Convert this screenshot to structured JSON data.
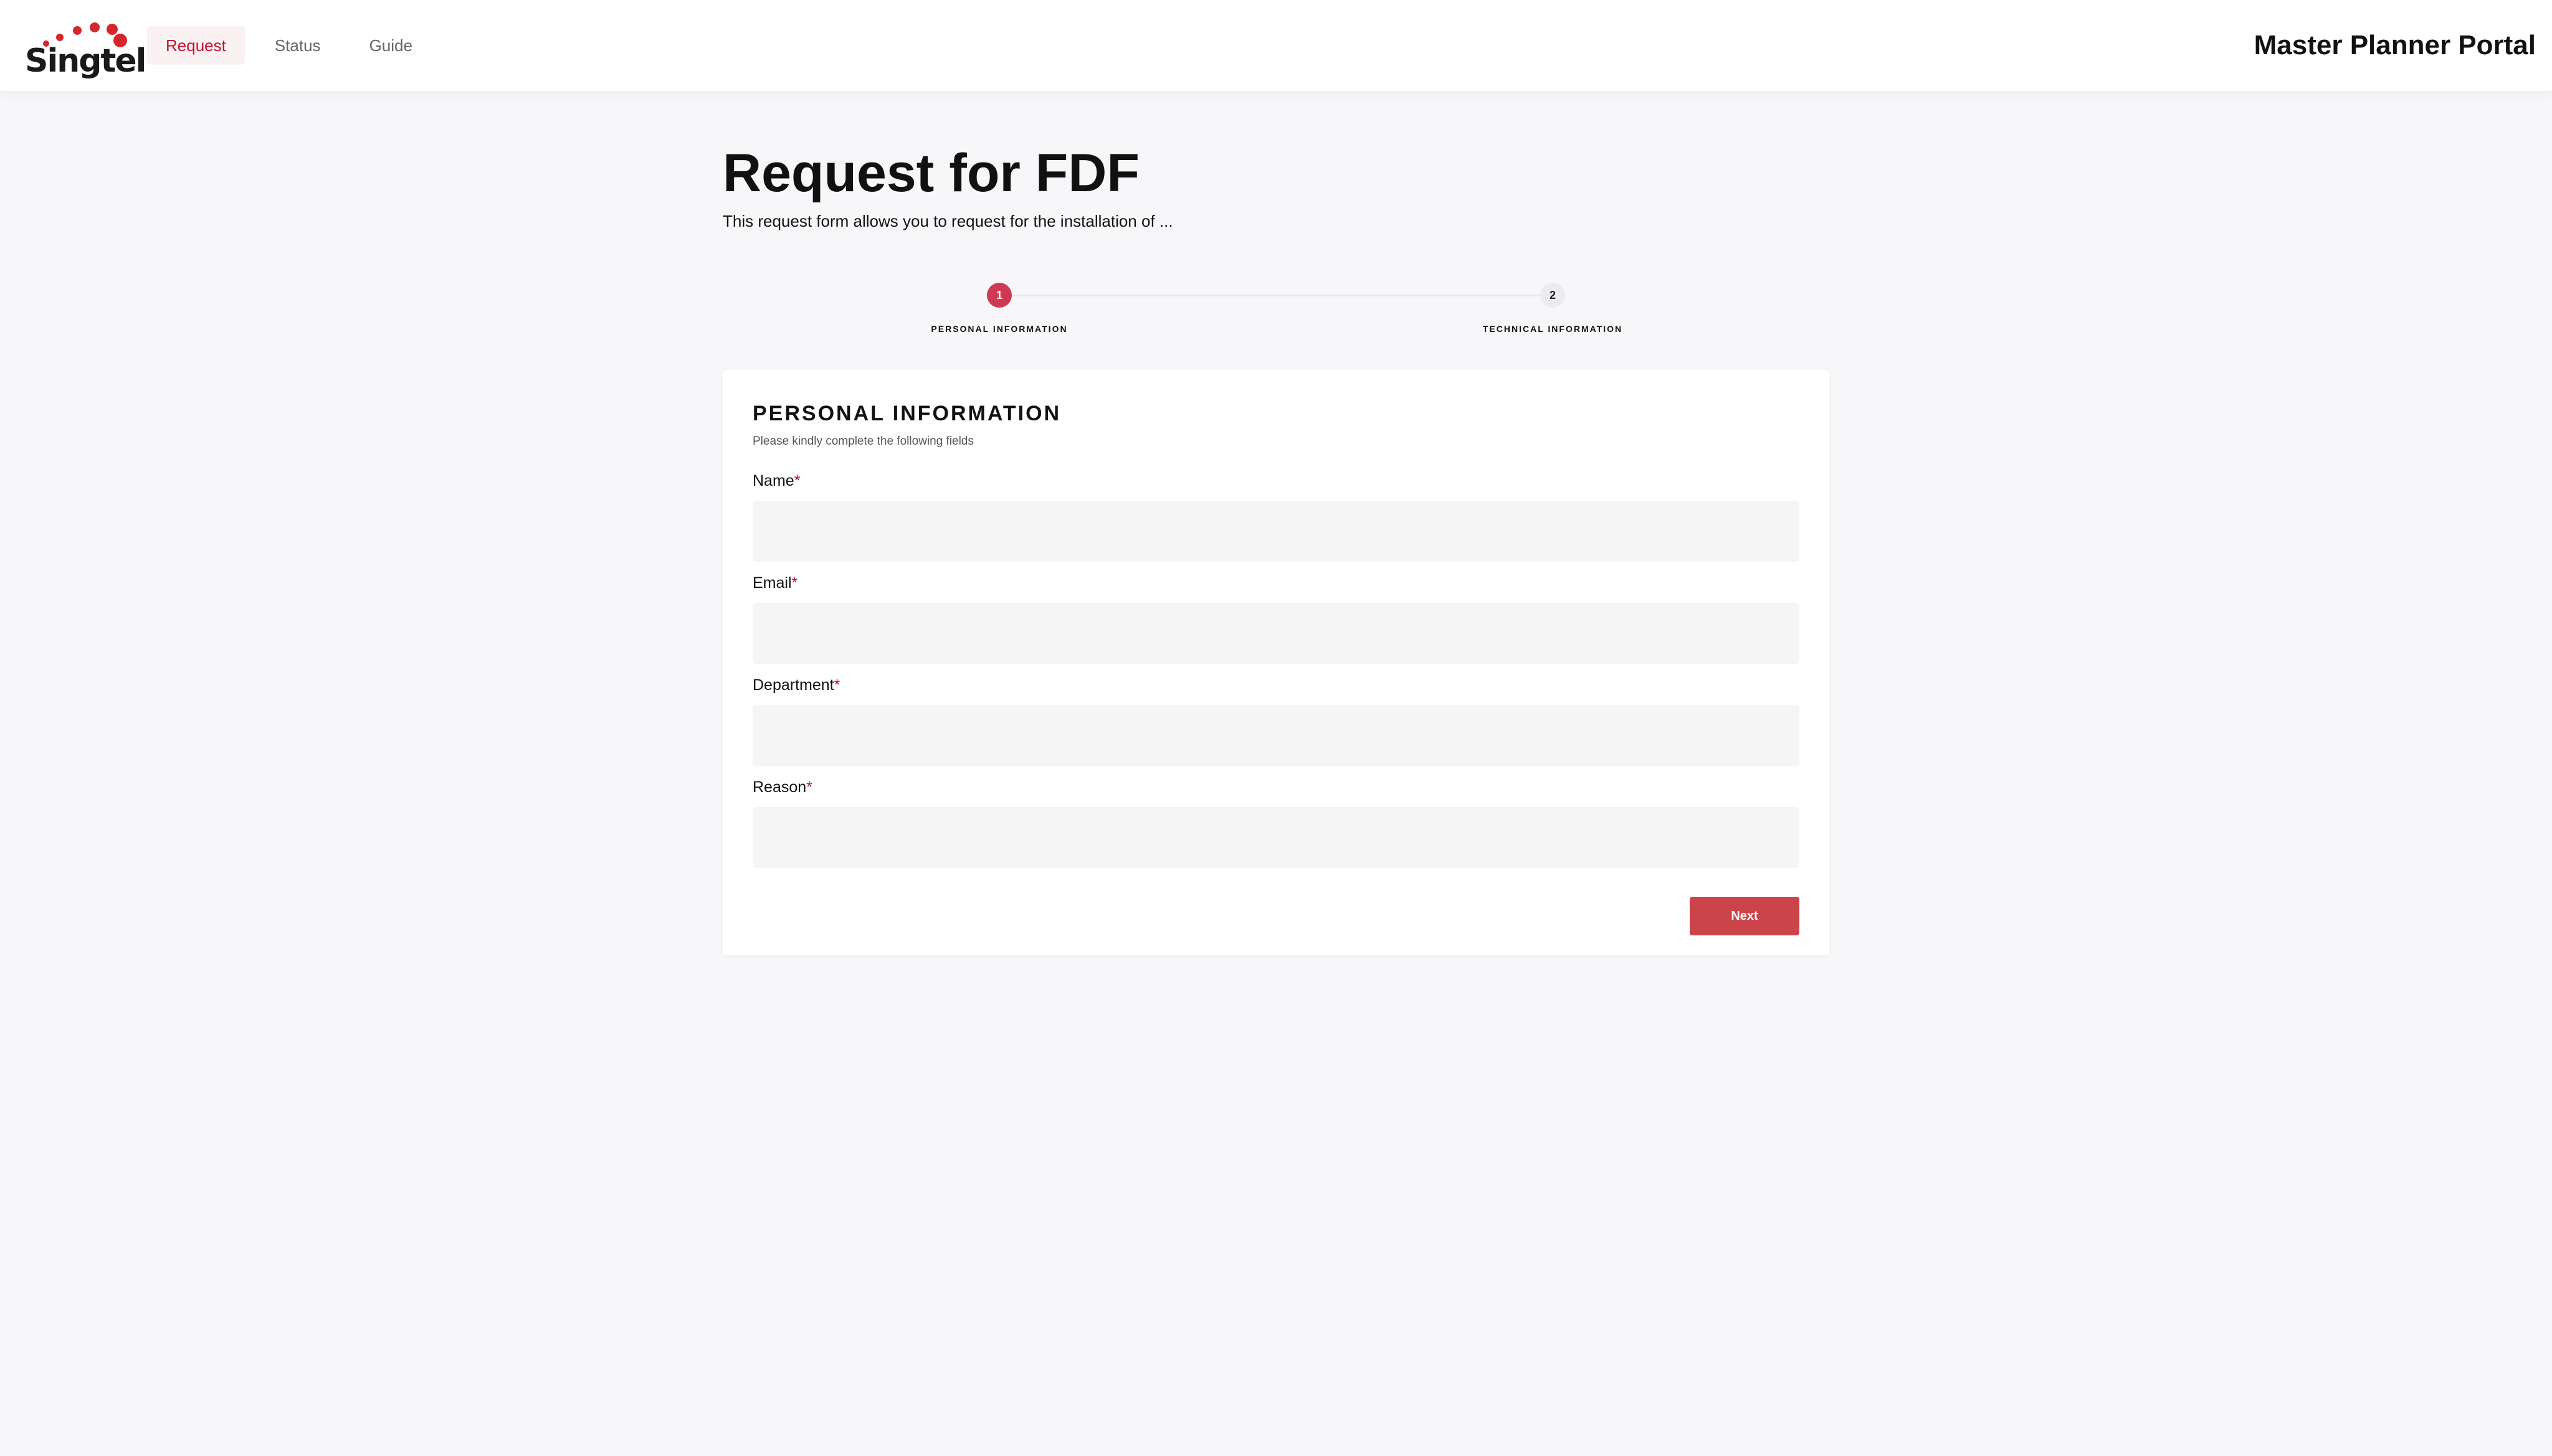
{
  "header": {
    "brand": "Singtel",
    "nav": [
      {
        "label": "Request",
        "active": true
      },
      {
        "label": "Status",
        "active": false
      },
      {
        "label": "Guide",
        "active": false
      }
    ],
    "portal_title": "Master Planner Portal"
  },
  "page": {
    "title": "Request for FDF",
    "subtitle": "This request form allows you to request for the installation of ..."
  },
  "stepper": {
    "steps": [
      {
        "number": "1",
        "label": "PERSONAL INFORMATION",
        "active": true
      },
      {
        "number": "2",
        "label": "TECHNICAL INFORMATION",
        "active": false
      }
    ]
  },
  "form": {
    "title": "PERSONAL INFORMATION",
    "subtitle": "Please kindly complete the following fields",
    "required_marker": "*",
    "fields": [
      {
        "label": "Name",
        "value": ""
      },
      {
        "label": "Email",
        "value": ""
      },
      {
        "label": "Department",
        "value": ""
      },
      {
        "label": "Reason",
        "value": ""
      }
    ],
    "next_label": "Next"
  },
  "colors": {
    "accent": "#c8102e",
    "button": "#cc444b",
    "background": "#f7f7f9",
    "input_bg": "#f5f5f5"
  }
}
